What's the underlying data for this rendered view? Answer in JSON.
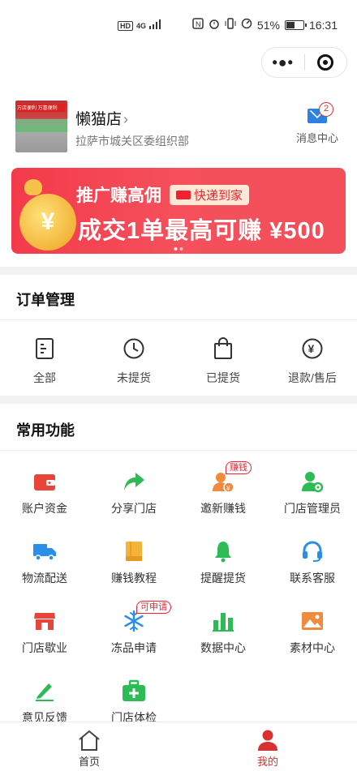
{
  "status_bar": {
    "left_badge": "HD",
    "left_signal": "4G",
    "battery": "51%",
    "battery_level": 0.51,
    "time": "16:31"
  },
  "capsule": {
    "more_icon": "more-dots-icon",
    "close_icon": "target-icon"
  },
  "store": {
    "name": "懒猫店",
    "address": "拉萨市城关区委组织部",
    "photo_sign": "万店便利  万喜便利",
    "message_label": "消息中心",
    "message_count": "2"
  },
  "banner": {
    "tag1": "推广赚高佣",
    "tag2": "快递到家",
    "headline": "成交1单最高可赚 ¥500",
    "coin_symbol": "¥"
  },
  "orders": {
    "title": "订单管理",
    "items": [
      {
        "label": "全部",
        "icon": "document-icon"
      },
      {
        "label": "未提货",
        "icon": "clock-icon"
      },
      {
        "label": "已提货",
        "icon": "bag-icon"
      },
      {
        "label": "退款/售后",
        "icon": "yen-circle-icon"
      }
    ]
  },
  "functions": {
    "title": "常用功能",
    "items": [
      {
        "label": "账户资金",
        "icon": "wallet-icon",
        "color": "#e8443a"
      },
      {
        "label": "分享门店",
        "icon": "share-icon",
        "color": "#2dbb55"
      },
      {
        "label": "邀新赚钱",
        "icon": "invite-icon",
        "color": "#f08a3c",
        "tag": "赚钱"
      },
      {
        "label": "门店管理员",
        "icon": "admin-icon",
        "color": "#2dbb55"
      },
      {
        "label": "物流配送",
        "icon": "truck-icon",
        "color": "#2b8fe8"
      },
      {
        "label": "赚钱教程",
        "icon": "book-icon",
        "color": "#f3b43a"
      },
      {
        "label": "提醒提货",
        "icon": "bell-icon",
        "color": "#2dbb55"
      },
      {
        "label": "联系客服",
        "icon": "headset-icon",
        "color": "#2b8fe8"
      },
      {
        "label": "门店歇业",
        "icon": "store-icon",
        "color": "#e8443a"
      },
      {
        "label": "冻品申请",
        "icon": "snowflake-icon",
        "color": "#2b8fe8",
        "tag": "可申请"
      },
      {
        "label": "数据中心",
        "icon": "bar-chart-icon",
        "color": "#2dbb55"
      },
      {
        "label": "素材中心",
        "icon": "image-icon",
        "color": "#f08a3c"
      },
      {
        "label": "意见反馈",
        "icon": "edit-icon",
        "color": "#2dbb55"
      },
      {
        "label": "门店体检",
        "icon": "medkit-icon",
        "color": "#2dbb55"
      }
    ]
  },
  "tabbar": {
    "home_label": "首页",
    "mine_label": "我的",
    "active_color": "#d8312f"
  }
}
